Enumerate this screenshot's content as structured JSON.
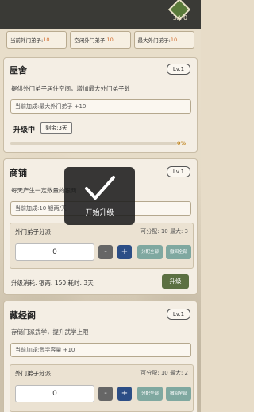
{
  "topbar": {
    "badge_value": "3A 0"
  },
  "stats": [
    {
      "label": "当前外门弟子:",
      "value": "10"
    },
    {
      "label": "空闲外门弟子:",
      "value": "10"
    },
    {
      "label": "最大外门弟子:",
      "value": "10"
    }
  ],
  "dormitory": {
    "title": "屋舍",
    "level": "Lv.1",
    "description": "提供外门弟子居住空间，增加最大外门弟子数",
    "bonus": "当前加成:最大外门弟子 +10",
    "upgrading_label": "升级中",
    "remaining": "剩余:3天",
    "progress_text": "0%",
    "progress": 0.0
  },
  "shop": {
    "title": "商铺",
    "level": "Lv.1",
    "description": "每天产生一定数量的银两",
    "bonus": "当前加成:10 银两/天",
    "assign_title": "外门弟子分派",
    "assign_meta": "可分配: 10  最大: 3",
    "input_value": "0",
    "minus": "-",
    "plus": "+",
    "assign_all": "分配全部",
    "recall_all": "撤回全部",
    "cost": "升级消耗: 银两: 150  耗时: 3天",
    "upgrade_label": "升级"
  },
  "library": {
    "title": "藏经阁",
    "level": "Lv.1",
    "description": "存储门派武学，提升武学上限",
    "bonus": "当前加成:武学容量 +10",
    "assign_title": "外门弟子分派",
    "assign_meta": "可分配: 10  最大: 2",
    "input_value": "0",
    "minus": "-",
    "plus": "+",
    "assign_all": "分配全部",
    "recall_all": "撤回全部"
  },
  "toast": {
    "message": "开始升级"
  },
  "colors": {
    "accent_orange": "#d16a2a",
    "upgrade_green": "#5c7042",
    "plus_blue": "#2c4e86",
    "teal": "#7fa8a0"
  }
}
